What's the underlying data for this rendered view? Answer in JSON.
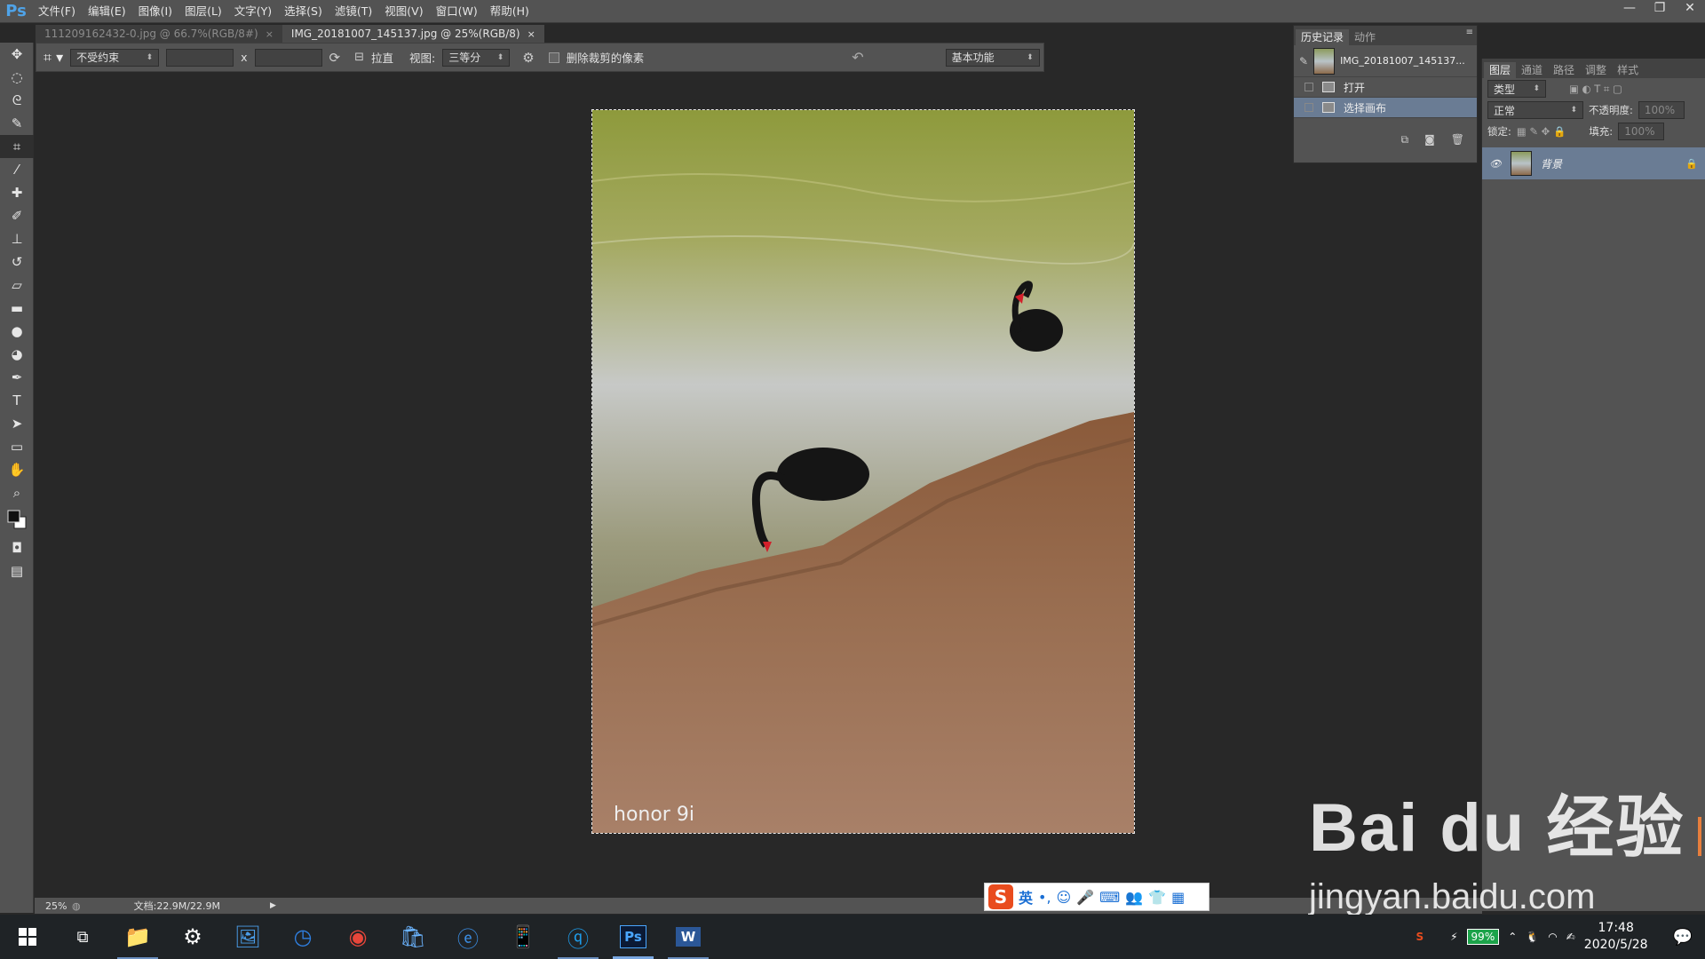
{
  "menubar": {
    "logo": "Ps",
    "items": [
      "文件(F)",
      "编辑(E)",
      "图像(I)",
      "图层(L)",
      "文字(Y)",
      "选择(S)",
      "滤镜(T)",
      "视图(V)",
      "窗口(W)",
      "帮助(H)"
    ],
    "window_controls": [
      "—",
      "❐",
      "✕"
    ]
  },
  "tabs": [
    {
      "label": "111209162432-0.jpg @ 66.7%(RGB/8#)",
      "close": "×",
      "active": false
    },
    {
      "label": "IMG_20181007_145137.jpg @ 25%(RGB/8)",
      "close": "×",
      "active": true
    }
  ],
  "options": {
    "ratio": "不受约束",
    "x_sep": "x",
    "straighten": "拉直",
    "view_label": "视图:",
    "view_value": "三等分",
    "delete_cropped": "删除裁剪的像素",
    "workspace": "基本功能"
  },
  "history": {
    "tabs": [
      "历史记录",
      "动作"
    ],
    "snapshot": "IMG_20181007_145137...",
    "items": [
      {
        "label": "打开",
        "selected": false
      },
      {
        "label": "选择画布",
        "selected": true
      }
    ]
  },
  "layers": {
    "tabs": [
      "图层",
      "通道",
      "路径",
      "调整",
      "样式"
    ],
    "filter": "类型",
    "blend": "正常",
    "opacity_label": "不透明度:",
    "opacity_value": "100%",
    "lock_label": "锁定:",
    "fill_label": "填充:",
    "fill_value": "100%",
    "layer_name": "背景"
  },
  "photo": {
    "watermark": "honor 9i"
  },
  "status": {
    "zoom": "25%",
    "doc": "文档:22.9M/22.9M"
  },
  "ime": {
    "logo": "S",
    "lang": "英"
  },
  "taskbar": {
    "battery": "99%",
    "time": "17:48",
    "date": "2020/5/28"
  },
  "watermark": {
    "brand": "Bai du 经验",
    "url": "jingyan.baidu.com"
  }
}
